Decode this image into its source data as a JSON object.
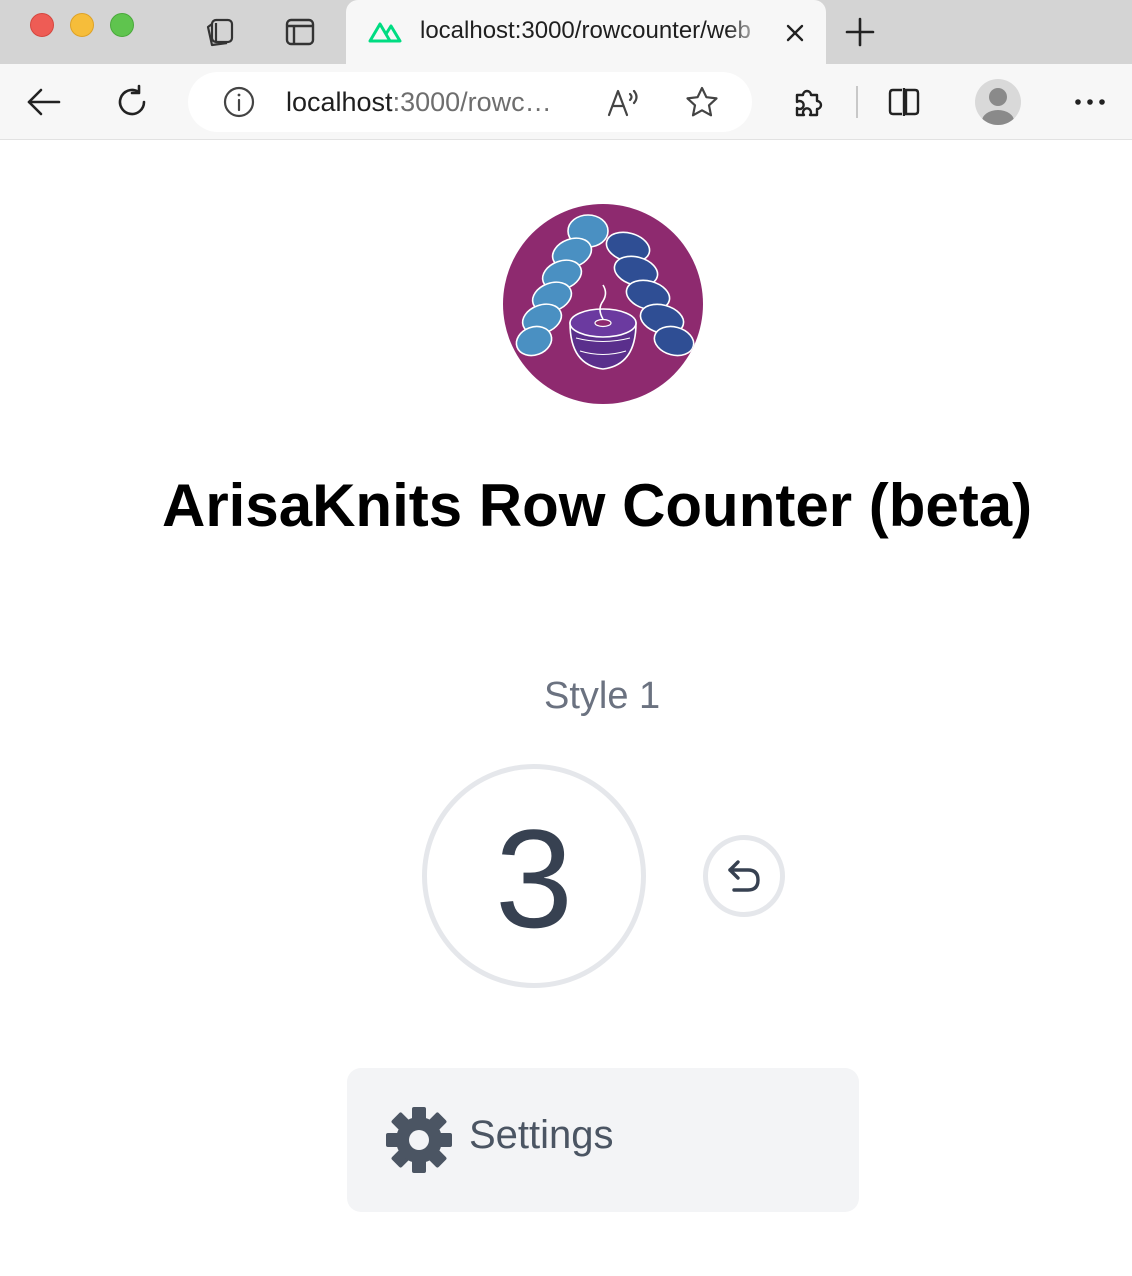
{
  "browser": {
    "tab": {
      "title": "localhost:3000/rowcounter/web",
      "favicon": "nuxt-logo-icon"
    },
    "address_bar": {
      "host": "localhost",
      "rest": ":3000/rowc…"
    },
    "icons": {
      "back": "back-arrow-icon",
      "refresh": "refresh-icon",
      "site_info": "info-icon",
      "read_aloud": "read-aloud-icon",
      "favorite": "star-icon",
      "extensions": "puzzle-icon",
      "split_screen": "split-screen-icon",
      "profile": "profile-avatar",
      "more": "more-horizontal-icon",
      "workspaces": "workspaces-icon",
      "tab_actions": "tab-actions-icon",
      "new_tab": "plus-icon",
      "close_tab": "close-icon"
    }
  },
  "page": {
    "title": "ArisaKnits Row Counter (beta)",
    "style_label": "Style 1",
    "counter_value": "3",
    "undo_icon": "undo-icon",
    "settings": {
      "label": "Settings",
      "icon": "gear-icon"
    }
  },
  "colors": {
    "logo_background": "#8e2a6f",
    "logo_yarn_light": "#4a90c2",
    "logo_yarn_dark": "#2f4e94",
    "logo_yarn_ball": "#5a2f8c",
    "counter_text": "#374151",
    "style_label": "#6b7280",
    "ring": "#e5e7eb",
    "settings_bg": "#f3f4f6",
    "settings_text": "#4b5563",
    "favicon_green": "#00dc82"
  }
}
